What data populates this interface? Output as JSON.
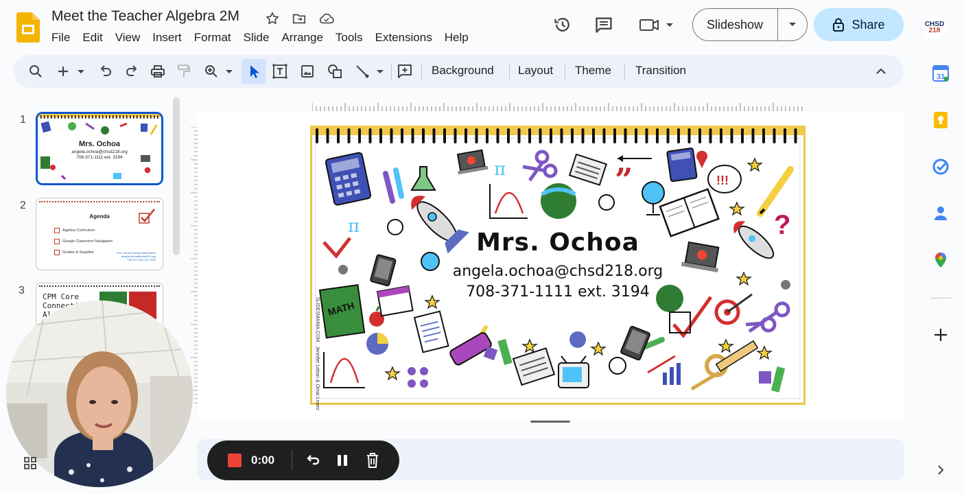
{
  "doc": {
    "title": "Meet the Teacher Algebra 2M"
  },
  "menu": [
    "File",
    "Edit",
    "View",
    "Insert",
    "Format",
    "Slide",
    "Arrange",
    "Tools",
    "Extensions",
    "Help"
  ],
  "header": {
    "slideshow_label": "Slideshow",
    "share_label": "Share",
    "avatar_text_1": "CHSD",
    "avatar_text_2": "218"
  },
  "toolbar": {
    "background_label": "Background",
    "layout_label": "Layout",
    "theme_label": "Theme",
    "transition_label": "Transition"
  },
  "filmstrip": {
    "slides": [
      {
        "number": "1",
        "name": "Mrs. Ochoa",
        "email": "angela.ochoa@chsd218.org",
        "phone": "708-371-1111 ext. 3194"
      },
      {
        "number": "2",
        "heading": "Agenda",
        "items": [
          "Algebra Curriculum",
          "Google Classroom Navigation",
          "Grades & Supplies"
        ],
        "contact_title": "Mrs. Ochoa Contact Information",
        "contact_email": "angela.ochoa@chsd218.org",
        "contact_phone": "708-371-1111 ext. 3194"
      },
      {
        "number": "3",
        "line1": "CPM Core",
        "line2": "Connection",
        "line3": "Alge"
      }
    ]
  },
  "slide": {
    "name": "Mrs. Ochoa",
    "email": "angela.ochoa@chsd218.org",
    "phone": "708-371-1111 ext. 3194",
    "side_credit": "SLIDESMANIA.COM · Jennifer Leban & Omar Lopez"
  },
  "recorder": {
    "timer": "0:00"
  },
  "colors": {
    "accent_blue": "#0b57d0",
    "share_bg": "#c2e7ff",
    "toolbar_bg": "#edf2fa",
    "slide_border_yellow": "#f2c94c",
    "recorder_bg": "#1f1f1f",
    "record_red": "#ea4335"
  }
}
